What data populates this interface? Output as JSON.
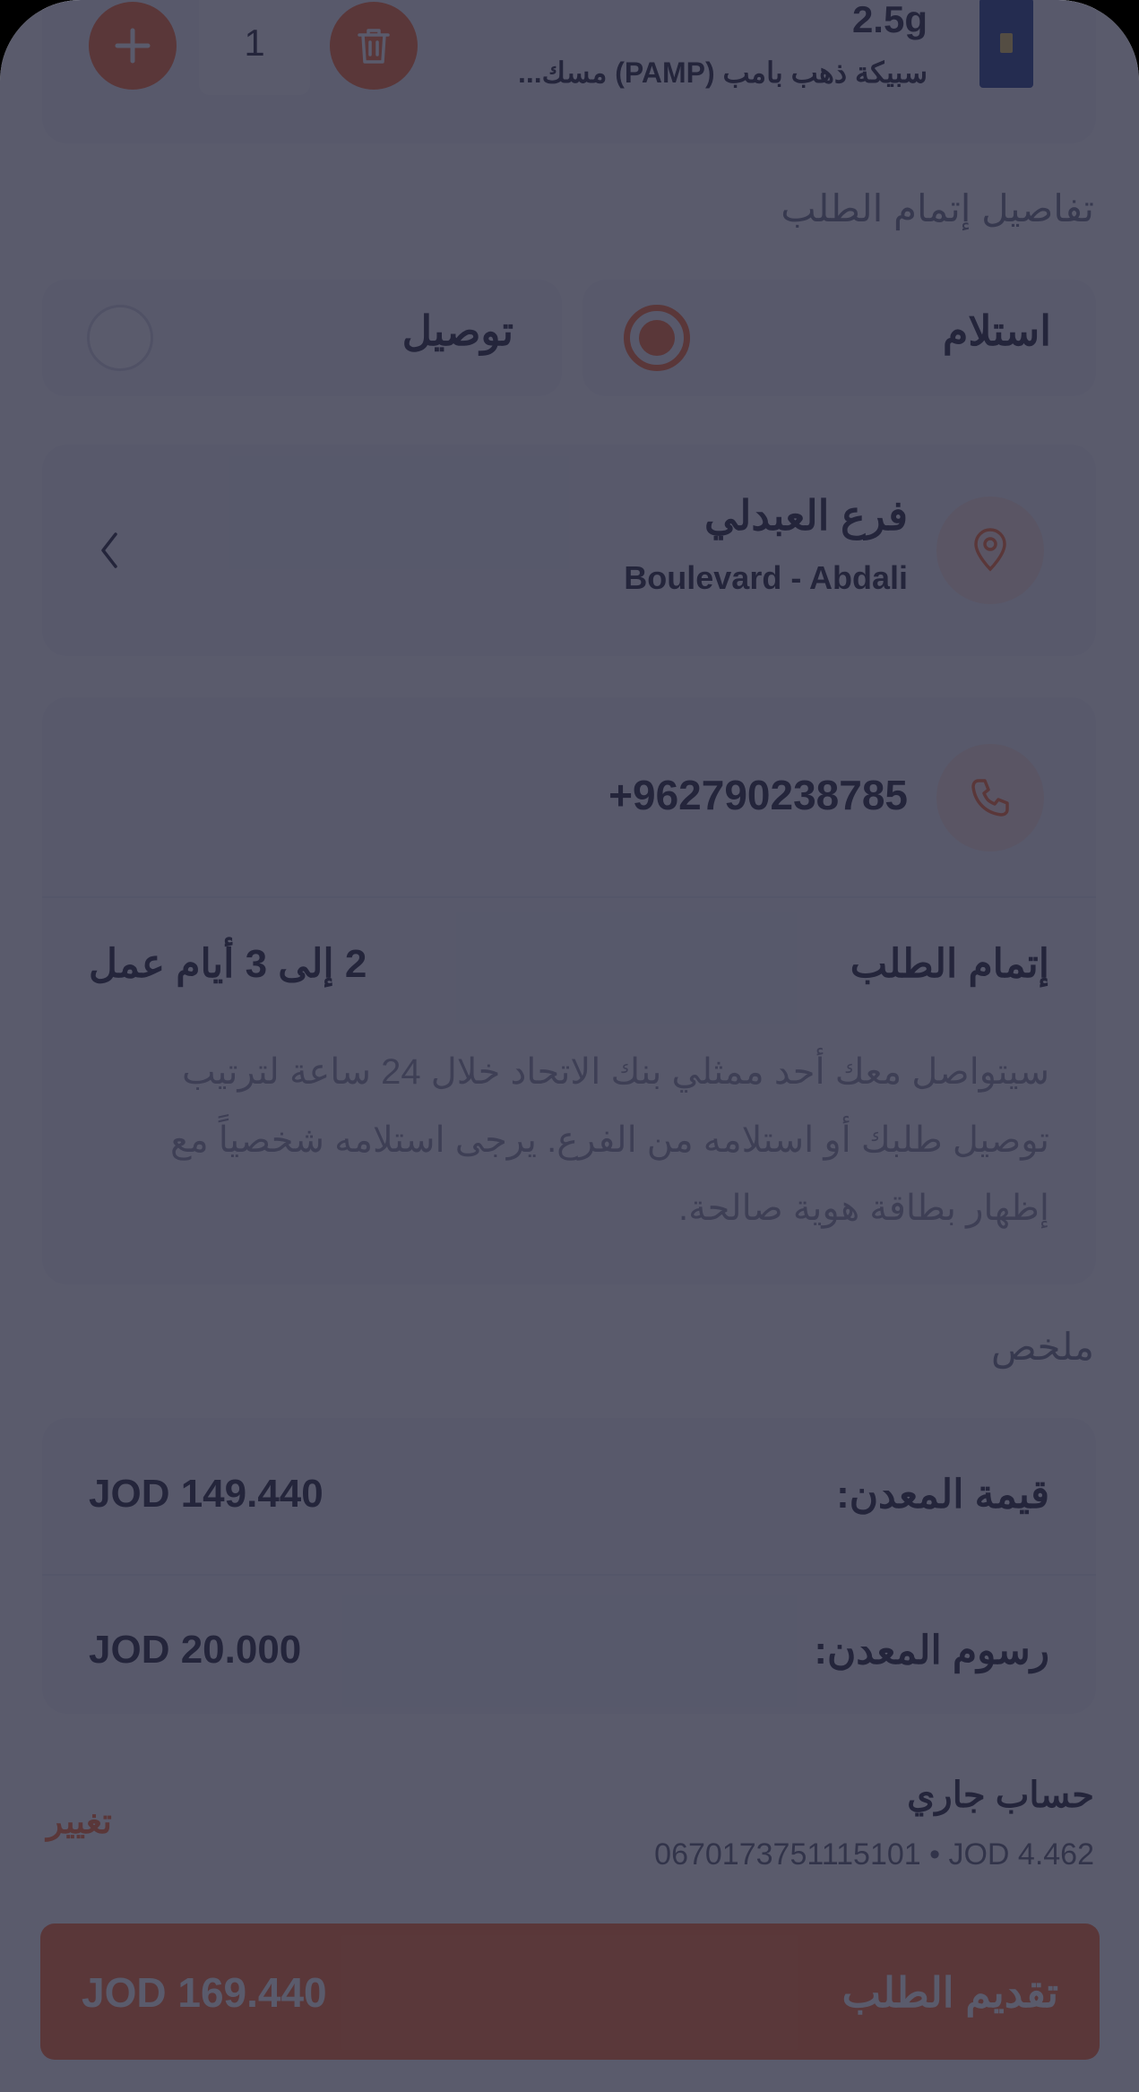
{
  "product": {
    "weight": "2.5g",
    "name": "سبيكة ذهب بامب (PAMP) مسك...",
    "quantity": "1"
  },
  "fulfillment": {
    "section_title": "تفاصيل إتمام الطلب",
    "options": [
      {
        "label": "استلام",
        "selected": true
      },
      {
        "label": "توصيل",
        "selected": false
      }
    ]
  },
  "branch": {
    "name": "فرع العبدلي",
    "address": "Boulevard - Abdali"
  },
  "contact": {
    "phone": "+962790238785"
  },
  "completion": {
    "title": "إتمام الطلب",
    "duration": "2 إلى 3 أيام عمل",
    "description_lines": [
      "سيتواصل معك أحد ممثلي بنك الاتحاد خلال 24 ساعة لترتيب",
      "توصيل طلبك أو استلامه من الفرع. يرجى استلامه شخصياً مع",
      "إظهار بطاقة هوية صالحة."
    ]
  },
  "summary": {
    "section_title": "ملخص",
    "rows": [
      {
        "label": "قيمة المعدن:",
        "value": "JOD 149.440"
      },
      {
        "label": "رسوم المعدن:",
        "value": "JOD 20.000"
      }
    ]
  },
  "account": {
    "title": "حساب جاري",
    "details": "0670173751115101 • JOD 4.462",
    "change_label": "تغيير"
  },
  "submit": {
    "label": "تقديم الطلب",
    "total": "JOD 169.440"
  },
  "colors": {
    "accent": "#ff6a2d",
    "overlay": "rgba(38,40,62,0.76)",
    "card_bg": "#f4f5fb"
  }
}
